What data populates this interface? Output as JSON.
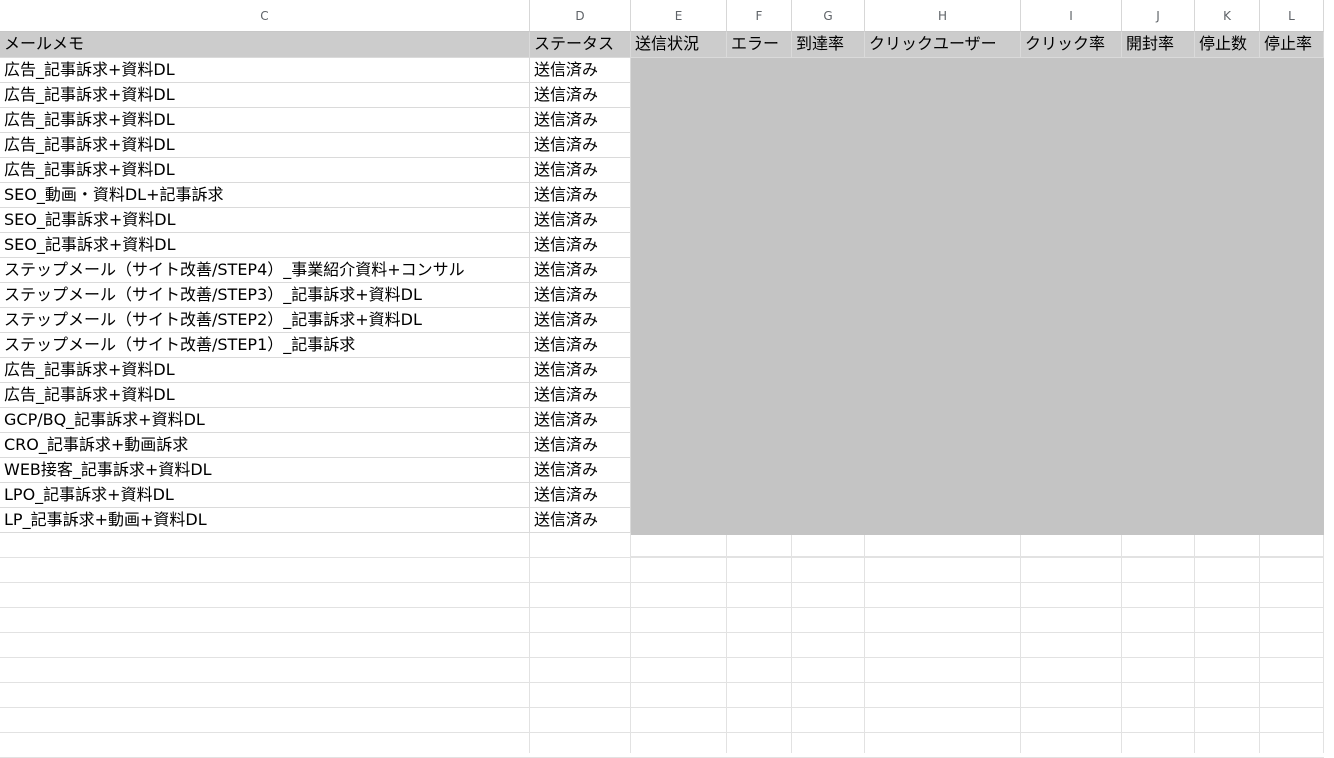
{
  "columns": [
    "C",
    "D",
    "E",
    "F",
    "G",
    "H",
    "I",
    "J",
    "K",
    "L"
  ],
  "header_row": [
    "メールメモ",
    "ステータス",
    "送信状況",
    "エラー",
    "到達率",
    "クリックユーザー",
    "クリック率",
    "開封率",
    "停止数",
    "停止率"
  ],
  "rows": [
    {
      "memo": "広告_記事訴求+資料DL",
      "status": "送信済み"
    },
    {
      "memo": "広告_記事訴求+資料DL",
      "status": "送信済み"
    },
    {
      "memo": "広告_記事訴求+資料DL",
      "status": "送信済み"
    },
    {
      "memo": "広告_記事訴求+資料DL",
      "status": "送信済み"
    },
    {
      "memo": "広告_記事訴求+資料DL",
      "status": "送信済み"
    },
    {
      "memo": "SEO_動画・資料DL+記事訴求",
      "status": "送信済み"
    },
    {
      "memo": "SEO_記事訴求+資料DL",
      "status": "送信済み"
    },
    {
      "memo": "SEO_記事訴求+資料DL",
      "status": "送信済み"
    },
    {
      "memo": "ステップメール（サイト改善/STEP4）_事業紹介資料+コンサル",
      "status": "送信済み"
    },
    {
      "memo": "ステップメール（サイト改善/STEP3）_記事訴求+資料DL",
      "status": "送信済み"
    },
    {
      "memo": "ステップメール（サイト改善/STEP2）_記事訴求+資料DL",
      "status": "送信済み"
    },
    {
      "memo": "ステップメール（サイト改善/STEP1）_記事訴求",
      "status": "送信済み"
    },
    {
      "memo": "広告_記事訴求+資料DL",
      "status": "送信済み"
    },
    {
      "memo": "広告_記事訴求+資料DL",
      "status": "送信済み"
    },
    {
      "memo": "GCP/BQ_記事訴求+資料DL",
      "status": "送信済み"
    },
    {
      "memo": "CRO_記事訴求+動画訴求",
      "status": "送信済み"
    },
    {
      "memo": "WEB接客_記事訴求+資料DL",
      "status": "送信済み"
    },
    {
      "memo": "LPO_記事訴求+資料DL",
      "status": "送信済み"
    },
    {
      "memo": "LP_記事訴求+動画+資料DL",
      "status": "送信済み"
    }
  ]
}
